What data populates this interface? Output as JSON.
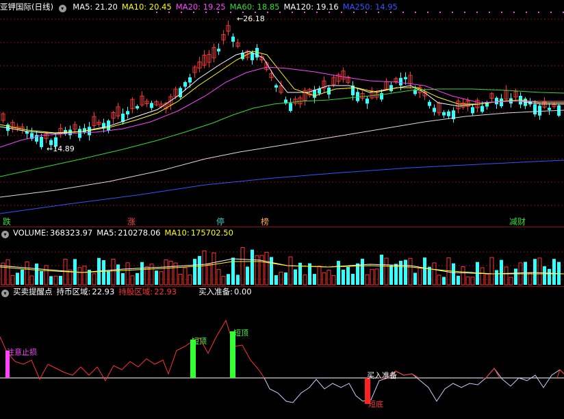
{
  "main": {
    "title": "亚钾国际(日线)",
    "ma": [
      {
        "label": "MA5:",
        "value": "21.20",
        "color": "#ffffff"
      },
      {
        "label": "MA10:",
        "value": "20.45",
        "color": "#ffff00"
      },
      {
        "label": "MA20:",
        "value": "19.25",
        "color": "#ff44ff"
      },
      {
        "label": "MA60:",
        "value": "18.85",
        "color": "#33dd33"
      },
      {
        "label": "MA120:",
        "value": "19.16",
        "color": "#ffffff"
      },
      {
        "label": "MA250:",
        "value": "14.95",
        "color": "#3355ff"
      }
    ],
    "high_label": "26.18",
    "low_label": "14.89",
    "badges": [
      {
        "text": "跌",
        "color": "#33dd33"
      },
      {
        "text": "涨",
        "color": "#ff4444"
      },
      {
        "text": "停",
        "color": "#33cccc"
      },
      {
        "text": "榜",
        "color": "#ffaa44"
      },
      {
        "text": "减财",
        "color": "#33dd33"
      }
    ]
  },
  "volume": {
    "label": "VOLUME:",
    "value": "368323.97",
    "ma5_label": "MA5:",
    "ma5_value": "210278.06",
    "ma10_label": "MA10:",
    "ma10_value": "175702.50"
  },
  "indicator": {
    "title": "买卖提醒点",
    "hold_label": "持币区域:",
    "hold_value": "22.93",
    "own_label": "持股区域:",
    "own_value": "22.93",
    "buy_label": "买入准备:",
    "buy_value": "0.00",
    "annotations": [
      {
        "text": "注意止损",
        "color": "#ff44ff"
      },
      {
        "text": "短顶",
        "color": "#33ff33"
      },
      {
        "text": "短顶",
        "color": "#33ff33"
      },
      {
        "text": "买入准备",
        "color": "#ffffff"
      },
      {
        "text": "短底",
        "color": "#ff3333"
      }
    ]
  },
  "colors": {
    "up": "#ff3333",
    "down": "#33ffff",
    "grid": "#8a1010"
  }
}
